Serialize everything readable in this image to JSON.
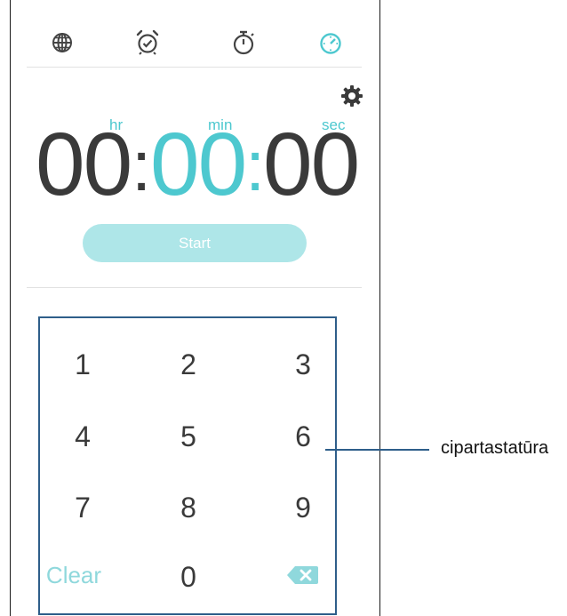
{
  "tabs": [
    {
      "id": "world-clock",
      "icon": "globe-icon",
      "active": false
    },
    {
      "id": "alarm",
      "icon": "alarm-clock-icon",
      "active": false
    },
    {
      "id": "stopwatch",
      "icon": "stopwatch-icon",
      "active": false
    },
    {
      "id": "timer",
      "icon": "timer-icon",
      "active": true
    }
  ],
  "settings": {
    "icon": "gear-icon"
  },
  "timer": {
    "hr_label": "hr",
    "min_label": "min",
    "sec_label": "sec",
    "hours": "00",
    "minutes": "00",
    "seconds": "00",
    "separator": ":",
    "start_label": "Start"
  },
  "keypad": {
    "keys": [
      "1",
      "2",
      "3",
      "4",
      "5",
      "6",
      "7",
      "8",
      "9"
    ],
    "clear_label": "Clear",
    "zero": "0",
    "backspace_icon": "backspace-icon"
  },
  "callout": {
    "label": "cipartastatūra"
  },
  "colors": {
    "accent": "#4dc8cf",
    "start_button_bg": "#aee6e8",
    "digit_text": "#3a3a3a",
    "keypad_border": "#2e5e8a",
    "icon_gray": "#444444"
  }
}
